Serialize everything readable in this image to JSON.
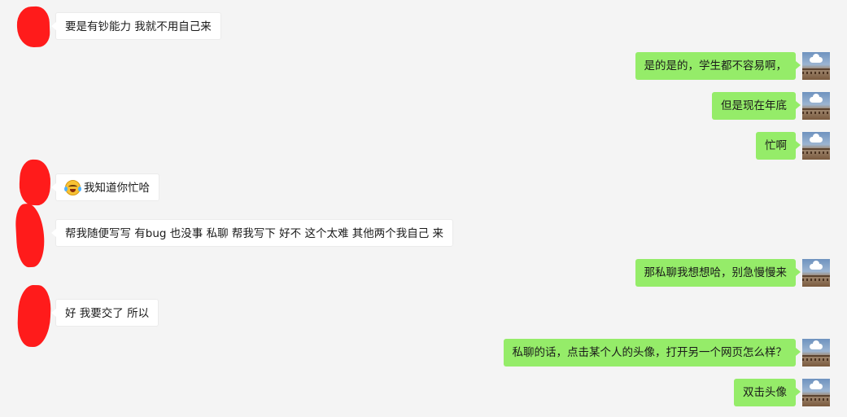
{
  "chat": {
    "messages": [
      {
        "side": "in",
        "text": "要是有钞能力 我就不用自己来"
      },
      {
        "side": "out",
        "text": "是的是的，学生都不容易啊，"
      },
      {
        "side": "out",
        "text": "但是现在年底"
      },
      {
        "side": "out",
        "text": "忙啊"
      },
      {
        "side": "in",
        "emoji": "laughing-tears-emoji",
        "text": "我知道你忙哈"
      },
      {
        "side": "in",
        "text": "帮我随便写写  有bug 也没事 私聊 帮我写下 好不 这个太难 其他两个我自己 来"
      },
      {
        "side": "out",
        "text": "那私聊我想想哈，别急慢慢来"
      },
      {
        "side": "in",
        "text": "好 我要交了 所以"
      },
      {
        "side": "out",
        "text": "私聊的话，点击某个人的头像，打开另一个网页怎么样？"
      },
      {
        "side": "out",
        "text": "双击头像"
      }
    ]
  },
  "colors": {
    "background": "#f4f4f4",
    "incoming_bubble": "#ffffff",
    "outgoing_bubble": "#95ec69",
    "redaction": "#ff1b1b"
  }
}
